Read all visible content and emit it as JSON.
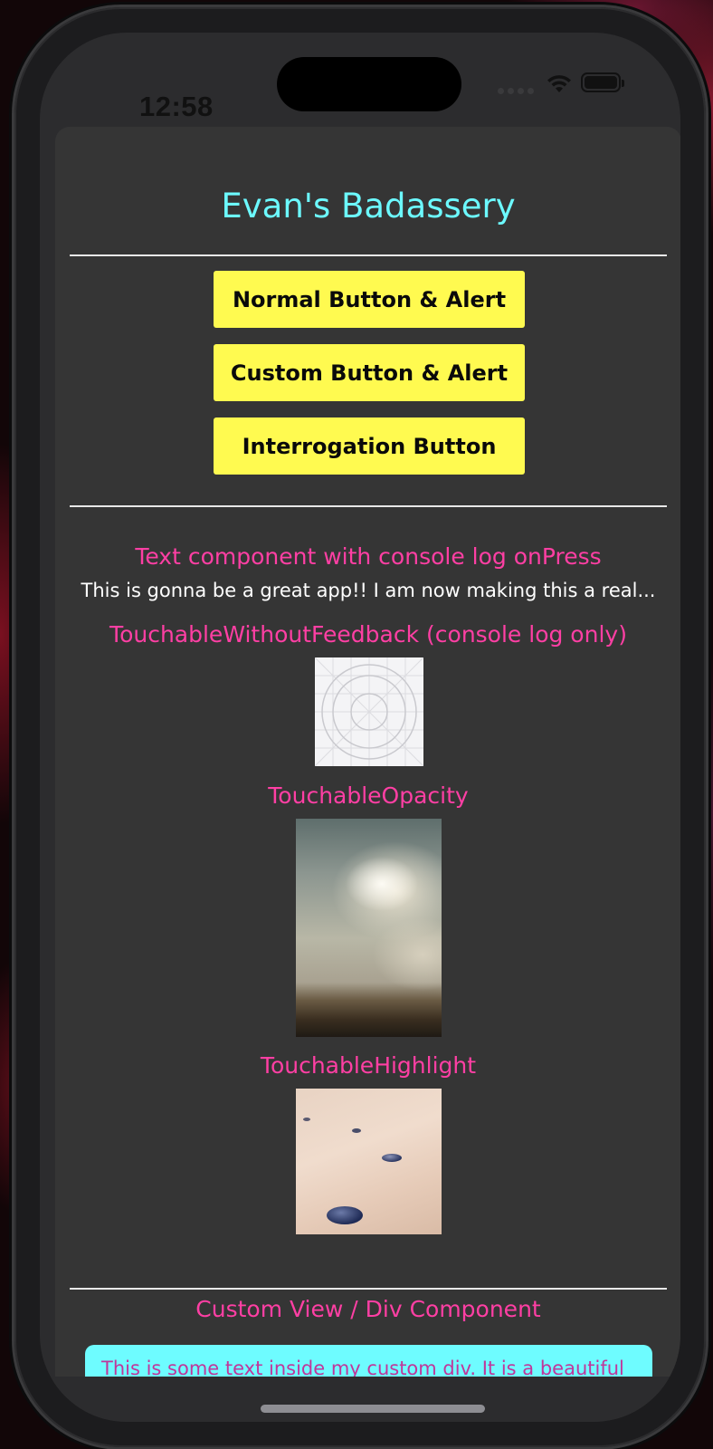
{
  "status_bar": {
    "time": "12:58"
  },
  "app": {
    "title": "Evan's Badassery",
    "buttons": [
      {
        "label": "Normal Button & Alert"
      },
      {
        "label": "Custom Button & Alert"
      },
      {
        "label": "Interrogation Button"
      }
    ],
    "text_component_label": "Text component with console log onPress",
    "text_component_body": "This is gonna be a great app!! I am now making this a real...",
    "touchable_without_feedback_label": "TouchableWithoutFeedback (console log only)",
    "touchable_opacity_label": "TouchableOpacity",
    "touchable_highlight_label": "TouchableHighlight",
    "custom_view_label": "Custom View / Div Component",
    "custom_div_text": "This is some text inside my custom div. It is a beautiful"
  },
  "colors": {
    "title": "#6cf9ff",
    "button_bg": "#fffa50",
    "accent_pink": "#ff3fa4",
    "sheet_bg": "#353535",
    "custom_div_bg": "#6efcff"
  },
  "icons": [
    "wifi-icon",
    "battery-icon",
    "signal-icon"
  ]
}
